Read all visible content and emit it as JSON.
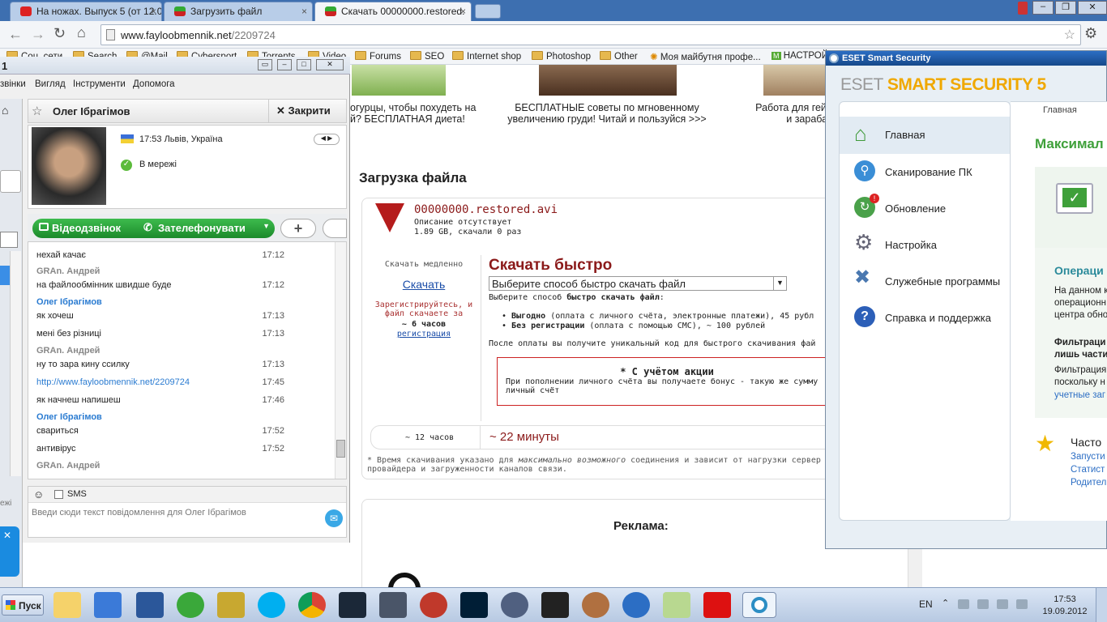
{
  "browser": {
    "tabs": [
      {
        "label": "На ножах. Выпуск 5 (от 12.0"
      },
      {
        "label": "Загрузить файл"
      },
      {
        "label": "Скачать 00000000.restored."
      }
    ],
    "url_host": "www.fayloobmennik.net",
    "url_path": "/2209724",
    "bookmarks": [
      "Соц. сети",
      "Search",
      "@Mail",
      "Cybersport",
      "Torrents",
      "Video",
      "Forums",
      "SEO",
      "Internet shop",
      "Photoshop",
      "Other",
      "Моя майбутня профе...",
      "НАСТРОЙ"
    ]
  },
  "page": {
    "ads": [
      {
        "text": "огурцы, чтобы похудеть на\nй? БЕСПЛАТНАЯ диета!"
      },
      {
        "text": "БЕСПЛАТНЫЕ советы по мгновенному\nувеличению груди! Читай и пользуйся >>>"
      },
      {
        "text": "Работа для геймеров\nи зарабатывай"
      }
    ],
    "heading": "Загрузка файла",
    "file": {
      "name": "00000000.restored.avi",
      "desc": "Описание отсутствует",
      "size": "1.89 GB, скачали 0 раз"
    },
    "slow": {
      "title": "Скачать медленно",
      "link": "Скачать",
      "note": "Зарегистрируйтесь, и файл скачаете за",
      "hours": "~ 6 часов",
      "reg": "регистрация"
    },
    "fast": {
      "title": "Скачать быстро",
      "select": "Выберите способ быстро скачать файл",
      "choose_pre": "Выберите способ ",
      "choose_bold": "быстро скачать файл",
      "choose_post": ":",
      "opt1_bold": "Выгодно",
      "opt1": " (оплата с личного счёта, электронные платежи), 45 рубл",
      "opt2_bold": "Без регистрации",
      "opt2": " (оплата с помощью СМС), ~ 100 рублей",
      "after": "После оплаты вы получите уникальный код для быстрого скачивания фай",
      "promo_title": "* С учётом акции",
      "promo_text": "При пополнении личного счёта вы получаете бонус - такую же сумму личный счёт"
    },
    "time_slow": "~ 12 часов",
    "time_fast": "~ 22 минуты",
    "note_pre": "* Время скачивания указано для ",
    "note_em": "максимально возможного",
    "note_post": " соединения и зависит от нагрузки сервер провайдера и загруженности каналов связи.",
    "ad_heading": "Реклама:"
  },
  "skype": {
    "title_fragment": "1",
    "menu": [
      "звінки",
      "Вигляд",
      "Інструменти",
      "Допомога"
    ],
    "contact_name": "Олег Ібрагімов",
    "close_label": "Закрити",
    "local_time": "17:53 Львів, Україна",
    "status": "В мережі",
    "video_call": "Відеодзвінок",
    "call": "Зателефонувати",
    "messages": [
      {
        "sender": "",
        "text": "нехай качає",
        "time": "17:12"
      },
      {
        "sender": "GRAn. Андрей",
        "text": "на файлообмінник швидше буде",
        "time": "17:12"
      },
      {
        "sender": "Олег Ібрагімов",
        "text": "як хочеш",
        "time": "17:13"
      },
      {
        "sender": "",
        "text": "мені без різниці",
        "time": "17:13"
      },
      {
        "sender": "GRAn. Андрей",
        "text": "ну то зара кину ссилку",
        "time": "17:13"
      },
      {
        "sender": "",
        "text": "http://www.fayloobmennik.net/2209724",
        "time": "17:45"
      },
      {
        "sender": "",
        "text": "як начнеш напишеш",
        "time": "17:46"
      },
      {
        "sender": "Олег Ібрагімов",
        "text": "свариться",
        "time": "17:52"
      },
      {
        "sender": "",
        "text": "антивірус",
        "time": "17:52"
      },
      {
        "sender": "GRAn. Андрей",
        "text": "",
        "time": ""
      }
    ],
    "sms_label": "SMS",
    "input_placeholder": "Введи сюди текст повідомлення для Олег Ібрагімов",
    "side_left": "ежі"
  },
  "eset": {
    "window_title": "ESET Smart Security",
    "brand_a": "ESET ",
    "brand_b": "SMART SECURITY 5",
    "nav": [
      "Главная",
      "Сканирование ПК",
      "Обновление",
      "Настройка",
      "Служебные программы",
      "Справка и поддержка"
    ],
    "breadcrumb": "Главная",
    "status_title": "Максимал",
    "op_title": "Операци",
    "op_text": "На данном к операционн центра обно",
    "filter_title": "Фильтраци лишь части",
    "filter_text": "Фильтрация поскольку н",
    "filter_link": "учетные заг",
    "often_title": "Часто",
    "often_links": [
      "Запусти",
      "Статист",
      "Родител"
    ]
  },
  "taskbar": {
    "start": "Пуск",
    "lang": "EN",
    "time": "17:53",
    "date": "19.09.2012"
  }
}
